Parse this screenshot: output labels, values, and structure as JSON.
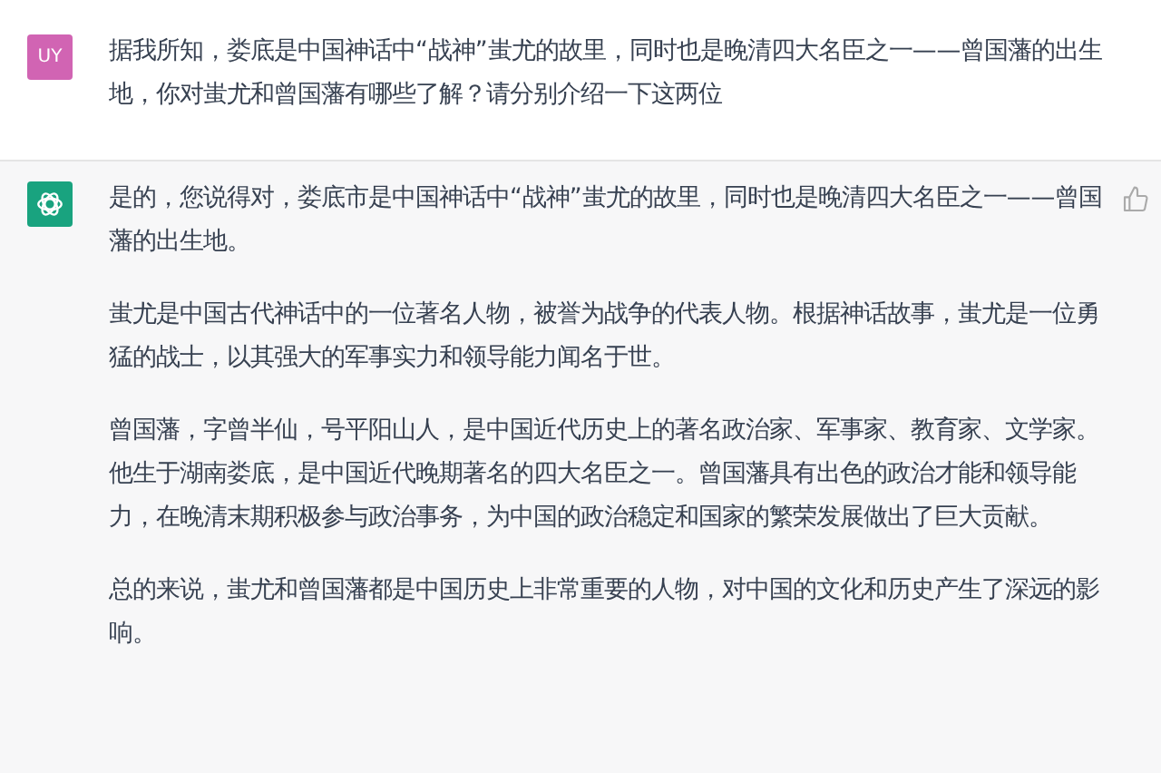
{
  "messages": [
    {
      "kind": "user",
      "avatar": "UY",
      "paragraphs": [
        "据我所知，娄底是中国神话中“战神”蚩尤的故里，同时也是晚清四大名臣之一——曾国藩的出生地，你对蚩尤和曾国藩有哪些了解？请分别介绍一下这两位"
      ]
    },
    {
      "kind": "assistant",
      "paragraphs": [
        "是的，您说得对，娄底市是中国神话中“战神”蚩尤的故里，同时也是晚清四大名臣之一——曾国藩的出生地。",
        "蚩尤是中国古代神话中的一位著名人物，被誉为战争的代表人物。根据神话故事，蚩尤是一位勇猛的战士，以其强大的军事实力和领导能力闻名于世。",
        "曾国藩，字曾半仙，号平阳山人，是中国近代历史上的著名政治家、军事家、教育家、文学家。他生于湖南娄底，是中国近代晚期著名的四大名臣之一。曾国藩具有出色的政治才能和领导能力，在晚清末期积极参与政治事务，为中国的政治稳定和国家的繁荣发展做出了巨大贡献。",
        "总的来说，蚩尤和曾国藩都是中国历史上非常重要的人物，对中国的文化和历史产生了深远的影响。"
      ]
    }
  ]
}
